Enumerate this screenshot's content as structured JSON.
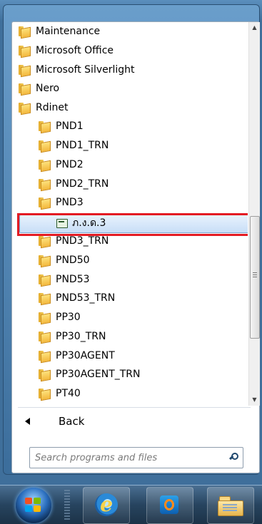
{
  "program_list": {
    "items": [
      {
        "label": "Maintenance",
        "level": 0
      },
      {
        "label": "Microsoft Office",
        "level": 0
      },
      {
        "label": "Microsoft Silverlight",
        "level": 0
      },
      {
        "label": "Nero",
        "level": 0
      },
      {
        "label": "Rdinet",
        "level": 0
      },
      {
        "label": "PND1",
        "level": 1
      },
      {
        "label": "PND1_TRN",
        "level": 1
      },
      {
        "label": "PND2",
        "level": 1
      },
      {
        "label": "PND2_TRN",
        "level": 1
      },
      {
        "label": "PND3",
        "level": 1
      },
      {
        "label": "ภ.ง.ด.3",
        "level": 2,
        "type": "application",
        "selected": true
      },
      {
        "label": "PND3_TRN",
        "level": 1
      },
      {
        "label": "PND50",
        "level": 1
      },
      {
        "label": "PND53",
        "level": 1
      },
      {
        "label": "PND53_TRN",
        "level": 1
      },
      {
        "label": "PP30",
        "level": 1
      },
      {
        "label": "PP30_TRN",
        "level": 1
      },
      {
        "label": "PP30AGENT",
        "level": 1
      },
      {
        "label": "PP30AGENT_TRN",
        "level": 1
      },
      {
        "label": "PT40",
        "level": 1
      }
    ]
  },
  "back": {
    "label": "Back"
  },
  "search": {
    "placeholder": "Search programs and files"
  },
  "taskbar": {
    "buttons": [
      "start-orb",
      "internet-explorer",
      "windows-media-player",
      "windows-explorer"
    ]
  },
  "colors": {
    "highlight_border": "#e31b23",
    "selected_background": "#c8def7"
  }
}
